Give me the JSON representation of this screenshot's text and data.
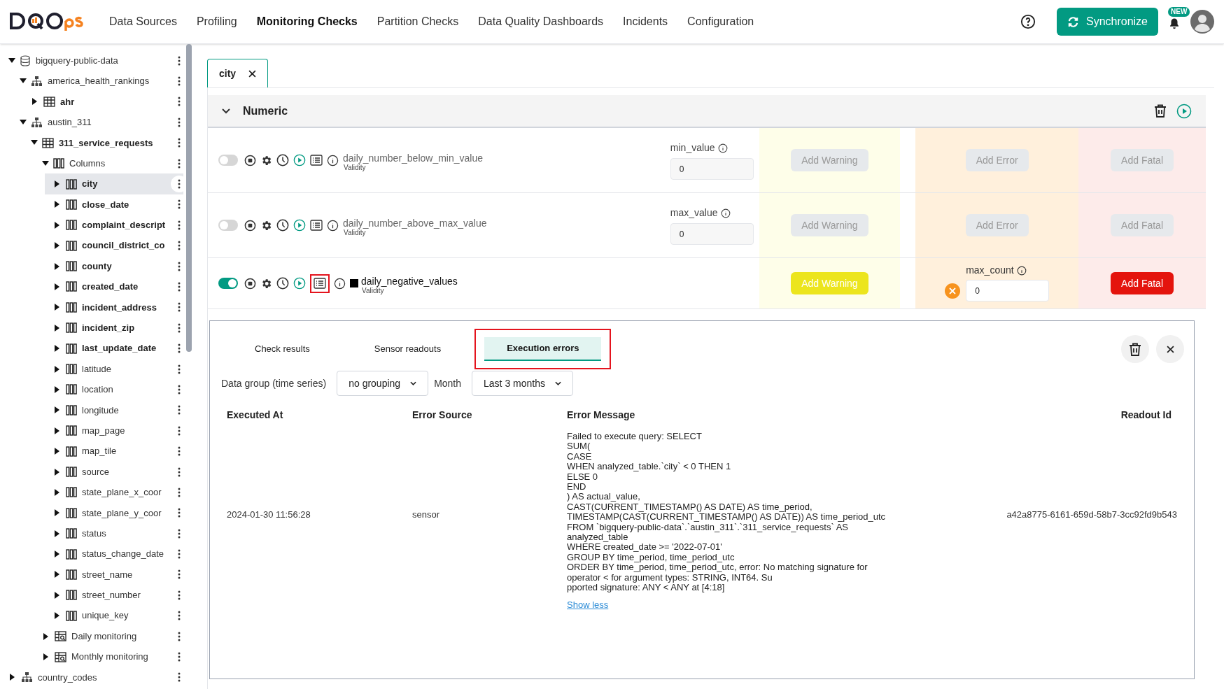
{
  "header": {
    "nav": [
      {
        "label": "Data Sources",
        "selected": false
      },
      {
        "label": "Profiling",
        "selected": false
      },
      {
        "label": "Monitoring Checks",
        "selected": true
      },
      {
        "label": "Partition Checks",
        "selected": false
      },
      {
        "label": "Data Quality Dashboards",
        "selected": false
      },
      {
        "label": "Incidents",
        "selected": false
      },
      {
        "label": "Configuration",
        "selected": false
      }
    ],
    "sync_button": "Synchronize",
    "new_badge": "NEW"
  },
  "tree": [
    {
      "kind": "database",
      "label": "bigquery-public-data",
      "expanded": true,
      "children": [
        {
          "kind": "schema",
          "label": "america_health_rankings",
          "expanded": true,
          "children": [
            {
              "kind": "table",
              "label": "ahr",
              "expanded": false,
              "bold": true
            }
          ]
        },
        {
          "kind": "schema",
          "label": "austin_311",
          "expanded": true,
          "children": [
            {
              "kind": "table",
              "label": "311_service_requests",
              "expanded": true,
              "bold": true,
              "children": [
                {
                  "kind": "columns",
                  "label": "Columns",
                  "expanded": true,
                  "children": [
                    {
                      "kind": "column",
                      "label": "city",
                      "bold": true,
                      "selected": true,
                      "expanded": false
                    },
                    {
                      "kind": "column",
                      "label": "close_date",
                      "bold": true,
                      "selected": false,
                      "expanded": false
                    },
                    {
                      "kind": "column",
                      "label": "complaint_descript",
                      "bold": true,
                      "selected": false,
                      "expanded": false
                    },
                    {
                      "kind": "column",
                      "label": "council_district_co",
                      "bold": true,
                      "selected": false,
                      "expanded": false
                    },
                    {
                      "kind": "column",
                      "label": "county",
                      "bold": true,
                      "selected": false,
                      "expanded": false
                    },
                    {
                      "kind": "column",
                      "label": "created_date",
                      "bold": true,
                      "selected": false,
                      "expanded": false
                    },
                    {
                      "kind": "column",
                      "label": "incident_address",
                      "bold": true,
                      "selected": false,
                      "expanded": false
                    },
                    {
                      "kind": "column",
                      "label": "incident_zip",
                      "bold": true,
                      "selected": false,
                      "expanded": false
                    },
                    {
                      "kind": "column",
                      "label": "last_update_date",
                      "bold": true,
                      "selected": false,
                      "expanded": false
                    },
                    {
                      "kind": "column",
                      "label": "latitude",
                      "bold": false,
                      "selected": false,
                      "expanded": false
                    },
                    {
                      "kind": "column",
                      "label": "location",
                      "bold": false,
                      "selected": false,
                      "expanded": false
                    },
                    {
                      "kind": "column",
                      "label": "longitude",
                      "bold": false,
                      "selected": false,
                      "expanded": false
                    },
                    {
                      "kind": "column",
                      "label": "map_page",
                      "bold": false,
                      "selected": false,
                      "expanded": false
                    },
                    {
                      "kind": "column",
                      "label": "map_tile",
                      "bold": false,
                      "selected": false,
                      "expanded": false
                    },
                    {
                      "kind": "column",
                      "label": "source",
                      "bold": false,
                      "selected": false,
                      "expanded": false
                    },
                    {
                      "kind": "column",
                      "label": "state_plane_x_coor",
                      "bold": false,
                      "selected": false,
                      "expanded": false
                    },
                    {
                      "kind": "column",
                      "label": "state_plane_y_coor",
                      "bold": false,
                      "selected": false,
                      "expanded": false
                    },
                    {
                      "kind": "column",
                      "label": "status",
                      "bold": false,
                      "selected": false,
                      "expanded": false
                    },
                    {
                      "kind": "column",
                      "label": "status_change_date",
                      "bold": false,
                      "selected": false,
                      "expanded": false
                    },
                    {
                      "kind": "column",
                      "label": "street_name",
                      "bold": false,
                      "selected": false,
                      "expanded": false
                    },
                    {
                      "kind": "column",
                      "label": "street_number",
                      "bold": false,
                      "selected": false,
                      "expanded": false
                    },
                    {
                      "kind": "column",
                      "label": "unique_key",
                      "bold": false,
                      "selected": false,
                      "expanded": false
                    }
                  ]
                },
                {
                  "kind": "checks",
                  "label": "Daily monitoring",
                  "expanded": false
                },
                {
                  "kind": "checks",
                  "label": "Monthly monitoring",
                  "expanded": false
                }
              ]
            }
          ]
        }
      ]
    },
    {
      "kind": "schema",
      "label": "country_codes",
      "expanded": false
    }
  ],
  "open_tabs": [
    {
      "label": "city",
      "selected": true
    }
  ],
  "section": {
    "title": "Numeric",
    "expanded": true
  },
  "checks": [
    {
      "enabled": false,
      "name": "daily_number_below_min_value",
      "category": "Validity",
      "configured": false,
      "highlighted": false,
      "param": {
        "label": "min_value",
        "value": "0"
      },
      "rules": [
        {
          "kind": "button",
          "label": "Add Warning",
          "active": false
        },
        {
          "kind": "button",
          "label": "Add Error",
          "active": false
        },
        {
          "kind": "button",
          "label": "Add Fatal",
          "active": false
        }
      ]
    },
    {
      "enabled": false,
      "name": "daily_number_above_max_value",
      "category": "Validity",
      "configured": false,
      "highlighted": false,
      "param": {
        "label": "max_value",
        "value": "0"
      },
      "rules": [
        {
          "kind": "button",
          "label": "Add Warning",
          "active": false
        },
        {
          "kind": "button",
          "label": "Add Error",
          "active": false
        },
        {
          "kind": "button",
          "label": "Add Fatal",
          "active": false
        }
      ]
    },
    {
      "enabled": true,
      "name": "daily_negative_values",
      "category": "Validity",
      "configured": true,
      "highlighted": true,
      "rules": [
        {
          "kind": "button",
          "label": "Add Warning",
          "active": true
        },
        {
          "kind": "param",
          "label": "max_count",
          "value": "0"
        },
        {
          "kind": "button",
          "label": "Add Fatal",
          "active": true
        }
      ]
    }
  ],
  "results": {
    "tabs": [
      {
        "label": "Check results",
        "selected": false,
        "highlighted": false
      },
      {
        "label": "Sensor readouts",
        "selected": false,
        "highlighted": false
      },
      {
        "label": "Execution errors",
        "selected": true,
        "highlighted": true
      }
    ],
    "filters": [
      {
        "label": "Data group (time series)",
        "value": "no grouping"
      },
      {
        "label": "Month",
        "value": "Last 3 months"
      }
    ],
    "columns": [
      "Executed At",
      "Error Source",
      "Error Message",
      "Readout Id"
    ],
    "rows": [
      {
        "executed_at": "2024-01-30 11:56:28",
        "error_source": "sensor",
        "readout_id": "a42a8775-6161-659d-58b7-3cc92fd9b543",
        "error_message": [
          "Failed to execute query: SELECT",
          "SUM(",
          "CASE",
          "WHEN analyzed_table.`city` < 0 THEN 1",
          "ELSE 0",
          "END",
          ") AS actual_value,",
          "CAST(CURRENT_TIMESTAMP() AS DATE) AS time_period,",
          "TIMESTAMP(CAST(CURRENT_TIMESTAMP() AS DATE)) AS time_period_utc",
          "FROM `bigquery-public-data`.`austin_311`.`311_service_requests` AS",
          "analyzed_table",
          "WHERE created_date >= '2022-07-01'",
          "GROUP BY time_period, time_period_utc",
          "ORDER BY time_period, time_period_utc, error: No matching signature for",
          "operator < for argument types: STRING, INT64. Su",
          "pported signature: ANY < ANY at [4:18]"
        ],
        "toggle_link": "Show less"
      }
    ]
  }
}
